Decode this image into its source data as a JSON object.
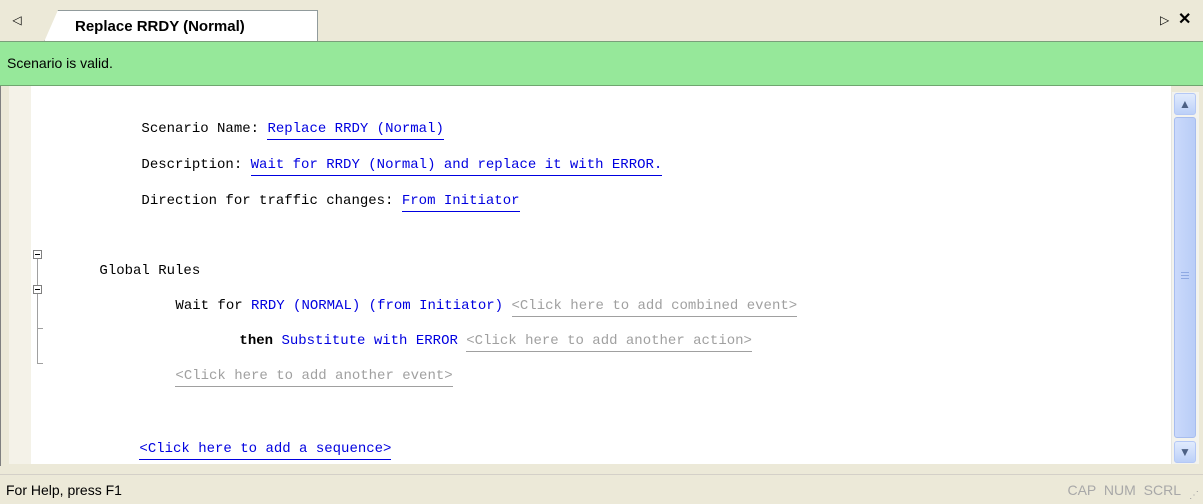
{
  "tab": {
    "left_arrow": "◁",
    "title": "Replace RRDY (Normal)",
    "right_arrow": "▷",
    "close": "✕"
  },
  "status_banner": {
    "text": "Scenario is valid.",
    "color": "#96e89a"
  },
  "scenario": {
    "name_label": "Scenario Name: ",
    "name_value": "Replace RRDY (Normal)",
    "description_label": "Description: ",
    "description_value": "Wait for RRDY (Normal) and replace it with ERROR.",
    "direction_label": "Direction for traffic changes: ",
    "direction_value": "From Initiator"
  },
  "rules": {
    "global_rules_label": "Global Rules",
    "wait_for_label": "Wait for ",
    "event_name": "RRDY (NORMAL) (from Initiator)",
    "add_combined_event": "<Click here to add combined event>",
    "then_label": "then ",
    "action_name": "Substitute with ERROR",
    "add_another_action": "<Click here to add another action>",
    "add_another_event": "<Click here to add another event>",
    "add_sequence": "<Click here to add a sequence>"
  },
  "scrollbar": {
    "up_icon": "▲",
    "down_icon": "▼"
  },
  "statusbar": {
    "help": "For Help, press F1",
    "indicators": "CAP NUM SCRL"
  },
  "colors": {
    "link": "#0000e0",
    "hint": "#a0a0a0"
  }
}
